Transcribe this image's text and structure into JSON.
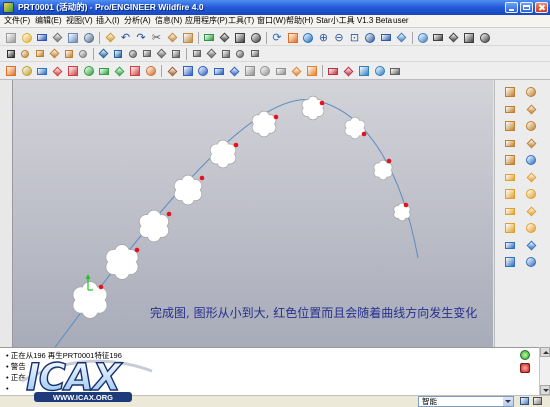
{
  "window": {
    "title": "PRT0001 (活动的) - Pro/ENGINEER Wildfire 4.0"
  },
  "menu": {
    "items": [
      "文件(F)",
      "编辑(E)",
      "视图(V)",
      "插入(I)",
      "分析(A)",
      "信息(N)",
      "应用程序(P)",
      "工具(T)",
      "窗口(W)",
      "帮助(H)",
      "Star小工具 V1.3 Beta",
      "user"
    ]
  },
  "toolbars": {
    "row1": [
      [
        "new-file-icon",
        "#9a9a9a"
      ],
      [
        "open-file-icon",
        "#e0b030"
      ],
      [
        "save-icon",
        "#2f55b0"
      ],
      [
        "print-icon",
        "#707070"
      ],
      [
        "send-mail-icon",
        "#6a8ab8"
      ],
      [
        "print-preview-icon",
        "#507090"
      ],
      "|",
      [
        "copy-icon",
        "#c89a30"
      ],
      [
        "undo-icon",
        "#1f4fa0"
      ],
      [
        "redo-icon",
        "#1f4fa0"
      ],
      [
        "cut-icon",
        "#505050"
      ],
      [
        "paste-icon",
        "#c08a40"
      ],
      [
        "paste-special-icon",
        "#c08a40"
      ],
      "|",
      [
        "regenerate-icon",
        "#2a9a40"
      ],
      [
        "find-icon",
        "#404040"
      ],
      [
        "select-box-icon",
        "#404040"
      ],
      [
        "filter-dropdown-icon",
        "#404040"
      ],
      "|",
      [
        "repaint-icon",
        "#2070c0"
      ],
      [
        "spin-center-icon",
        "#e07020"
      ],
      [
        "orient-mode-icon",
        "#2070c0"
      ],
      [
        "zoom-in-icon",
        "#305ca0"
      ],
      [
        "zoom-out-icon",
        "#305ca0"
      ],
      [
        "refit-icon",
        "#305ca0"
      ],
      [
        "reorient-icon",
        "#305ca0"
      ],
      [
        "saved-views-icon",
        "#305ca0"
      ],
      [
        "layers-icon",
        "#4080c0"
      ],
      "|",
      [
        "view-manager-icon",
        "#4080c0"
      ],
      [
        "wireframe-icon",
        "#404040"
      ],
      [
        "hidden-line-icon",
        "#404040"
      ],
      [
        "no-hidden-icon",
        "#404040"
      ],
      [
        "shading-icon",
        "#404040"
      ]
    ],
    "row2": [
      [
        "select-icon",
        "#303030"
      ],
      [
        "datum-plane-display-icon",
        "#c08030"
      ],
      [
        "datum-axis-display-icon",
        "#c08030"
      ],
      [
        "datum-point-display-icon",
        "#c08030"
      ],
      [
        "csys-display-icon",
        "#c08030"
      ],
      [
        "annotation-display-icon",
        "#808080"
      ],
      "|",
      [
        "model-tree-icon",
        "#2060a0"
      ],
      [
        "sketcher-icon",
        "#2060a0"
      ],
      [
        "layer-tree-icon",
        "#606060"
      ],
      [
        "relations-icon",
        "#606060"
      ],
      [
        "parameters-icon",
        "#606060"
      ],
      [
        "family-table-icon",
        "#606060"
      ],
      "|",
      [
        "measure-icon",
        "#606060"
      ],
      [
        "distance-icon",
        "#606060"
      ],
      [
        "curvature-icon",
        "#606060"
      ],
      [
        "section-icon",
        "#606060"
      ],
      [
        "mass-properties-icon",
        "#606060"
      ]
    ],
    "row3": [
      [
        "offset-icon",
        "#e07020"
      ],
      [
        "sketched-datum-icon",
        "#c0a030"
      ],
      [
        "analysis-icon",
        "#3070c0"
      ],
      [
        "graph-icon",
        "#d04040"
      ],
      [
        "curvature-analysis-icon",
        "#d04040"
      ],
      [
        "draft-check-icon",
        "#30a040"
      ],
      [
        "slope-icon",
        "#30a040"
      ],
      [
        "reflection-icon",
        "#30a040"
      ],
      [
        "dihedral-icon",
        "#d04040"
      ],
      [
        "shaded-curvature-icon",
        "#d07030"
      ],
      "|",
      [
        "user-feature-icon",
        "#a06030"
      ],
      [
        "copy-feature-icon",
        "#3060c0"
      ],
      [
        "group-icon",
        "#3060c0"
      ],
      [
        "pattern-icon",
        "#3060c0"
      ],
      [
        "mirror-icon",
        "#3060c0"
      ],
      [
        "merge-icon",
        "#909090"
      ],
      [
        "trim-icon",
        "#909090"
      ],
      [
        "extend-icon",
        "#909090"
      ],
      [
        "thicken-icon",
        "#e08030"
      ],
      [
        "solidify-icon",
        "#e08030"
      ],
      "|",
      [
        "project-icon",
        "#c03040"
      ],
      [
        "intersect-icon",
        "#c03040"
      ],
      [
        "wrap-icon",
        "#3080c0"
      ],
      [
        "flatten-icon",
        "#3080c0"
      ],
      [
        "remove-icon",
        "#606060"
      ]
    ],
    "right": [
      [
        "datum-plane-icon",
        "#c08030"
      ],
      [
        "sketched-curve-icon",
        "#c08030"
      ],
      [
        "datum-axis-icon",
        "#c08030"
      ],
      [
        "datum-curve-icon",
        "#c08030"
      ],
      [
        "datum-point-icon",
        "#c08030"
      ],
      [
        "point-array-icon",
        "#c08030"
      ],
      [
        "coordinate-system-icon",
        "#c08030"
      ],
      [
        "sketch-tool-icon",
        "#c08030"
      ],
      [
        "analysis-feature-icon",
        "#c08030"
      ],
      [
        "hole-icon",
        "#3070c0"
      ],
      [
        "round-icon",
        "#e0a030"
      ],
      [
        "chamfer-icon",
        "#e0a030"
      ],
      [
        "draft-icon",
        "#e0a030"
      ],
      [
        "rib-icon",
        "#e0a030"
      ],
      [
        "shell-icon",
        "#e0a030"
      ],
      [
        "extrude-icon",
        "#e0a030"
      ],
      [
        "revolve-icon",
        "#e0a030"
      ],
      [
        "sweep-icon",
        "#e0a030"
      ],
      [
        "blend-icon",
        "#3070c0"
      ],
      [
        "boundary-blend-icon",
        "#3070c0"
      ],
      [
        "style-icon",
        "#3070c0"
      ],
      [
        "warp-icon",
        "#3070c0"
      ]
    ]
  },
  "graphics": {
    "caption": "完成图, 图形从小到大, 红色位置而且会随着曲线方向发生变化"
  },
  "colors": {
    "graphics_top": "#d3d3d9",
    "graphics_bottom": "#a8abb9",
    "curve": "#5b8cc0",
    "marker": "#e8101c",
    "sketch_fill": "#ffffff",
    "sketch_outline": "#a4a4a4",
    "start_arrow": "#22c022"
  },
  "messages": [
    "• 正在从196 再生PRT0001特征196",
    "• 警告",
    "• 正在",
    "•"
  ],
  "logo": {
    "text": "ICAX",
    "url": "WWW.ICAX.ORG"
  },
  "status": {
    "selection_filter": "智能"
  }
}
